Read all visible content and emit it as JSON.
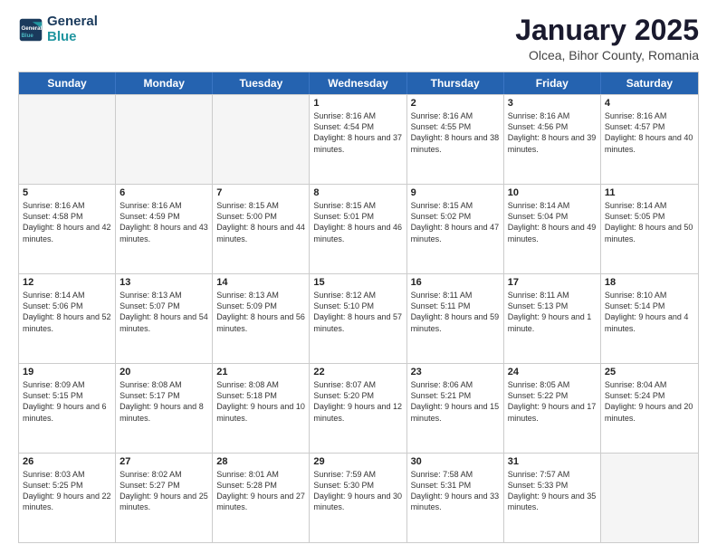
{
  "logo": {
    "line1": "General",
    "line2": "Blue"
  },
  "title": "January 2025",
  "subtitle": "Olcea, Bihor County, Romania",
  "days": [
    "Sunday",
    "Monday",
    "Tuesday",
    "Wednesday",
    "Thursday",
    "Friday",
    "Saturday"
  ],
  "weeks": [
    [
      {
        "num": "",
        "info": "",
        "empty": true
      },
      {
        "num": "",
        "info": "",
        "empty": true
      },
      {
        "num": "",
        "info": "",
        "empty": true
      },
      {
        "num": "1",
        "info": "Sunrise: 8:16 AM\nSunset: 4:54 PM\nDaylight: 8 hours\nand 37 minutes."
      },
      {
        "num": "2",
        "info": "Sunrise: 8:16 AM\nSunset: 4:55 PM\nDaylight: 8 hours\nand 38 minutes."
      },
      {
        "num": "3",
        "info": "Sunrise: 8:16 AM\nSunset: 4:56 PM\nDaylight: 8 hours\nand 39 minutes."
      },
      {
        "num": "4",
        "info": "Sunrise: 8:16 AM\nSunset: 4:57 PM\nDaylight: 8 hours\nand 40 minutes."
      }
    ],
    [
      {
        "num": "5",
        "info": "Sunrise: 8:16 AM\nSunset: 4:58 PM\nDaylight: 8 hours\nand 42 minutes."
      },
      {
        "num": "6",
        "info": "Sunrise: 8:16 AM\nSunset: 4:59 PM\nDaylight: 8 hours\nand 43 minutes."
      },
      {
        "num": "7",
        "info": "Sunrise: 8:15 AM\nSunset: 5:00 PM\nDaylight: 8 hours\nand 44 minutes."
      },
      {
        "num": "8",
        "info": "Sunrise: 8:15 AM\nSunset: 5:01 PM\nDaylight: 8 hours\nand 46 minutes."
      },
      {
        "num": "9",
        "info": "Sunrise: 8:15 AM\nSunset: 5:02 PM\nDaylight: 8 hours\nand 47 minutes."
      },
      {
        "num": "10",
        "info": "Sunrise: 8:14 AM\nSunset: 5:04 PM\nDaylight: 8 hours\nand 49 minutes."
      },
      {
        "num": "11",
        "info": "Sunrise: 8:14 AM\nSunset: 5:05 PM\nDaylight: 8 hours\nand 50 minutes."
      }
    ],
    [
      {
        "num": "12",
        "info": "Sunrise: 8:14 AM\nSunset: 5:06 PM\nDaylight: 8 hours\nand 52 minutes."
      },
      {
        "num": "13",
        "info": "Sunrise: 8:13 AM\nSunset: 5:07 PM\nDaylight: 8 hours\nand 54 minutes."
      },
      {
        "num": "14",
        "info": "Sunrise: 8:13 AM\nSunset: 5:09 PM\nDaylight: 8 hours\nand 56 minutes."
      },
      {
        "num": "15",
        "info": "Sunrise: 8:12 AM\nSunset: 5:10 PM\nDaylight: 8 hours\nand 57 minutes."
      },
      {
        "num": "16",
        "info": "Sunrise: 8:11 AM\nSunset: 5:11 PM\nDaylight: 8 hours\nand 59 minutes."
      },
      {
        "num": "17",
        "info": "Sunrise: 8:11 AM\nSunset: 5:13 PM\nDaylight: 9 hours\nand 1 minute."
      },
      {
        "num": "18",
        "info": "Sunrise: 8:10 AM\nSunset: 5:14 PM\nDaylight: 9 hours\nand 4 minutes."
      }
    ],
    [
      {
        "num": "19",
        "info": "Sunrise: 8:09 AM\nSunset: 5:15 PM\nDaylight: 9 hours\nand 6 minutes."
      },
      {
        "num": "20",
        "info": "Sunrise: 8:08 AM\nSunset: 5:17 PM\nDaylight: 9 hours\nand 8 minutes."
      },
      {
        "num": "21",
        "info": "Sunrise: 8:08 AM\nSunset: 5:18 PM\nDaylight: 9 hours\nand 10 minutes."
      },
      {
        "num": "22",
        "info": "Sunrise: 8:07 AM\nSunset: 5:20 PM\nDaylight: 9 hours\nand 12 minutes."
      },
      {
        "num": "23",
        "info": "Sunrise: 8:06 AM\nSunset: 5:21 PM\nDaylight: 9 hours\nand 15 minutes."
      },
      {
        "num": "24",
        "info": "Sunrise: 8:05 AM\nSunset: 5:22 PM\nDaylight: 9 hours\nand 17 minutes."
      },
      {
        "num": "25",
        "info": "Sunrise: 8:04 AM\nSunset: 5:24 PM\nDaylight: 9 hours\nand 20 minutes."
      }
    ],
    [
      {
        "num": "26",
        "info": "Sunrise: 8:03 AM\nSunset: 5:25 PM\nDaylight: 9 hours\nand 22 minutes."
      },
      {
        "num": "27",
        "info": "Sunrise: 8:02 AM\nSunset: 5:27 PM\nDaylight: 9 hours\nand 25 minutes."
      },
      {
        "num": "28",
        "info": "Sunrise: 8:01 AM\nSunset: 5:28 PM\nDaylight: 9 hours\nand 27 minutes."
      },
      {
        "num": "29",
        "info": "Sunrise: 7:59 AM\nSunset: 5:30 PM\nDaylight: 9 hours\nand 30 minutes."
      },
      {
        "num": "30",
        "info": "Sunrise: 7:58 AM\nSunset: 5:31 PM\nDaylight: 9 hours\nand 33 minutes."
      },
      {
        "num": "31",
        "info": "Sunrise: 7:57 AM\nSunset: 5:33 PM\nDaylight: 9 hours\nand 35 minutes."
      },
      {
        "num": "",
        "info": "",
        "empty": true
      }
    ]
  ]
}
